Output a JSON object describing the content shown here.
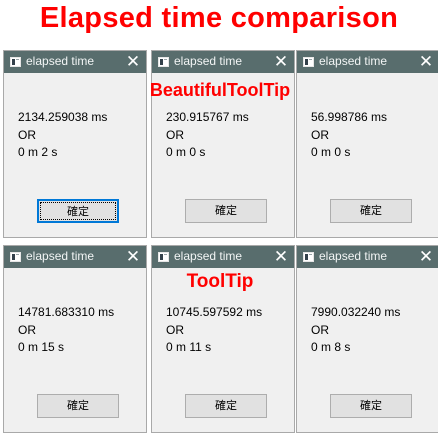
{
  "title": "Elapsed time comparison",
  "labels": {
    "beautiful": "BeautifulToolTip",
    "tooltip": "ToolTip"
  },
  "dialogs": [
    {
      "window_title": "elapsed time",
      "close": "✕",
      "ms": "2134.259038 ms",
      "or": "OR",
      "min_sec": "0 m 2 s",
      "button": "確定"
    },
    {
      "window_title": "elapsed time",
      "close": "✕",
      "ms": "230.915767 ms",
      "or": "OR",
      "min_sec": "0 m 0 s",
      "button": "確定"
    },
    {
      "window_title": "elapsed time",
      "close": "✕",
      "ms": "56.998786 ms",
      "or": "OR",
      "min_sec": "0 m 0 s",
      "button": "確定"
    },
    {
      "window_title": "elapsed time",
      "close": "✕",
      "ms": "14781.683310 ms",
      "or": "OR",
      "min_sec": "0 m 15 s",
      "button": "確定"
    },
    {
      "window_title": "elapsed time",
      "close": "✕",
      "ms": "10745.597592 ms",
      "or": "OR",
      "min_sec": "0 m 11 s",
      "button": "確定"
    },
    {
      "window_title": "elapsed time",
      "close": "✕",
      "ms": "7990.032240 ms",
      "or": "OR",
      "min_sec": "0 m 8 s",
      "button": "確定"
    }
  ],
  "colors": {
    "accent_red": "#ff0000",
    "titlebar": "#586d6d",
    "dialog_bg": "#f0f0f0",
    "focus_border": "#0078d7"
  },
  "icons": {
    "app": "window-app-icon",
    "close": "close-icon"
  }
}
